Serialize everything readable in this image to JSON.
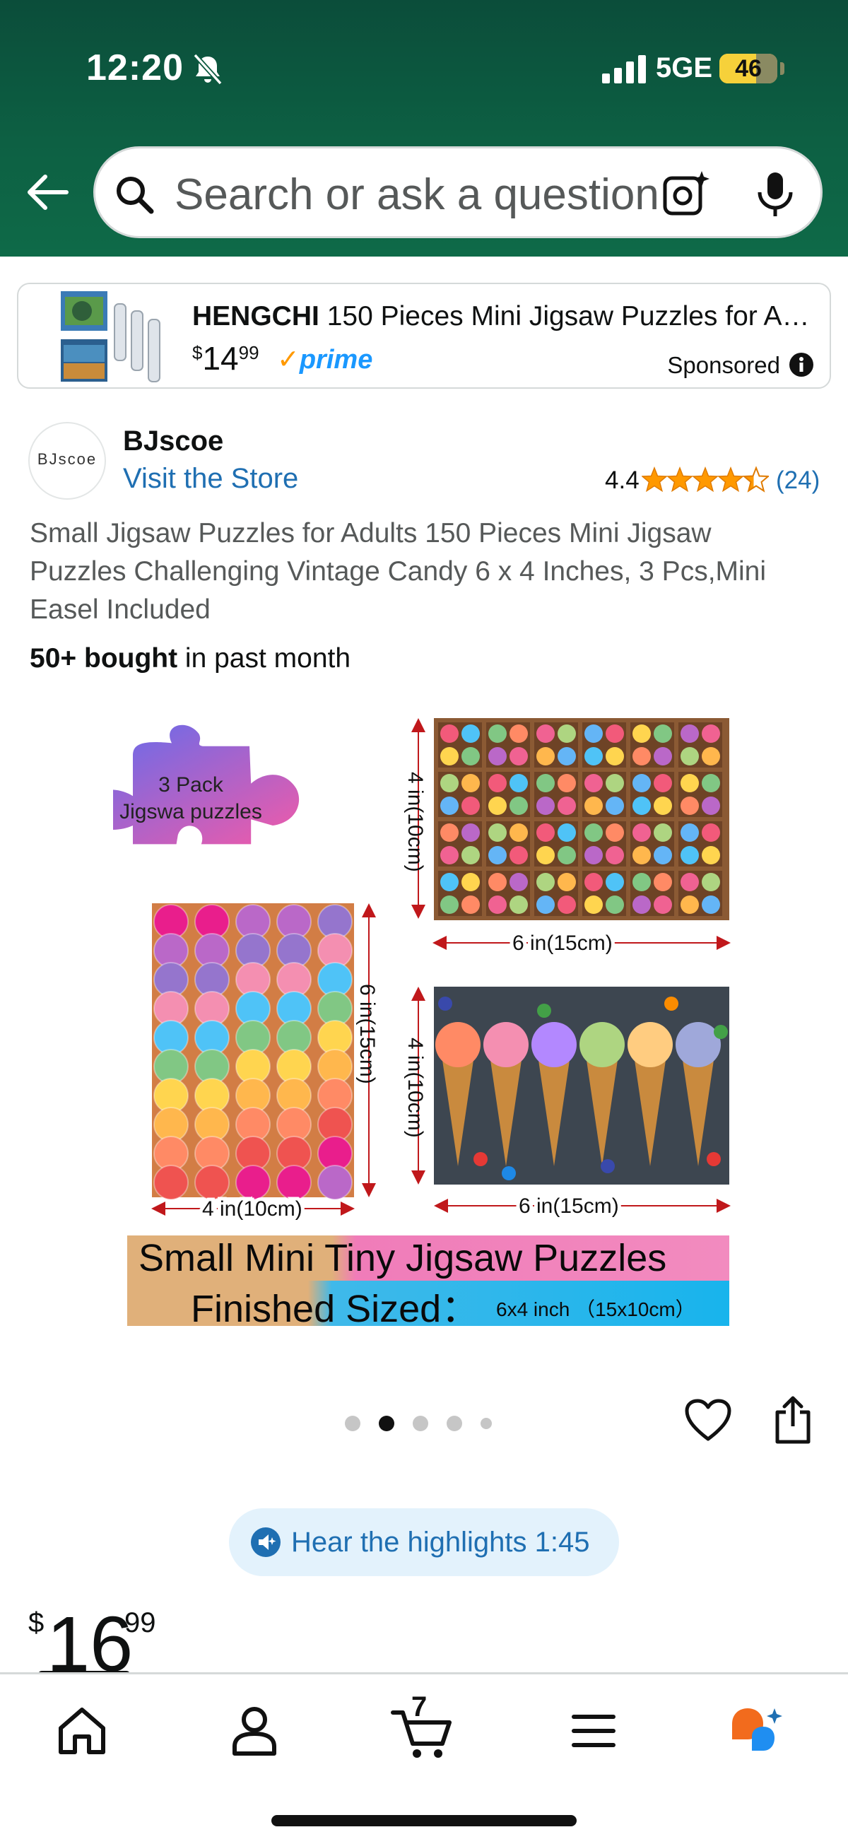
{
  "status_bar": {
    "time": "12:20",
    "network": "5GE",
    "battery": "46",
    "battery_level": 0.46
  },
  "search": {
    "placeholder": "Search or ask a question"
  },
  "sponsored": {
    "brand": "HENGCHI",
    "title": "150 Pieces Mini Jigsaw Puzzles for A…",
    "price_whole": "14",
    "price_fraction": "99",
    "price_symbol": "$",
    "prime_label": "prime",
    "label": "Sponsored"
  },
  "seller": {
    "logo_text": "BJscoe",
    "name": "BJscoe",
    "visit_store": "Visit the Store",
    "rating": "4.4",
    "rating_value": 4.4,
    "rating_count": "(24)"
  },
  "product": {
    "title": "Small Jigsaw Puzzles for Adults 150 Pieces Mini Jigsaw Puzzles Challenging Vintage Candy 6 x 4 Inches, 3 Pcs,Mini Easel Included",
    "bought_strong": "50+ bought",
    "bought_rest": " in past month",
    "image": {
      "piece_line1": "3 Pack",
      "piece_line2": "Jigswa puzzles",
      "dim_4in_v1": "4 in(10cm)",
      "dim_6in_h1": "6 in(15cm)",
      "dim_6in_v": "6 in(15cm)",
      "dim_4in_v2": "4 in(10cm)",
      "dim_4in_h": "4 in(10cm)",
      "dim_6in_h2": "6 in(15cm)",
      "banner_line1": "Small Mini Tiny Jigsaw Puzzles",
      "banner_line2": "Finished Sized：",
      "banner_size": "6x4 inch （15x10cm）"
    },
    "carousel": {
      "count": 5,
      "active_index": 1
    },
    "hear_highlights": "Hear the highlights 1:45",
    "price_symbol": "$",
    "price_whole": "16",
    "price_fraction": "99"
  },
  "bottom_nav": {
    "cart_count": "7",
    "items": [
      "home-icon",
      "account-icon",
      "cart-icon",
      "menu-icon",
      "rufus-icon"
    ]
  },
  "colors": {
    "header_green": "#0d6043",
    "link_blue": "#1f6fb2",
    "star_orange": "#ff9900",
    "prime_blue": "#1a98ff",
    "battery_yellow": "#f6d13a"
  }
}
